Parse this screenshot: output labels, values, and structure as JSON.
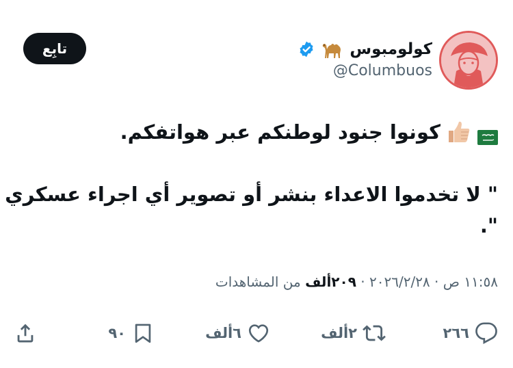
{
  "author": {
    "display_name": "كولومبوس",
    "handle": "@Columbuos",
    "verified": true
  },
  "follow_button": {
    "label": "تابِع"
  },
  "tweet": {
    "line1": "كونوا جنود لوطنكم عبر هواتفكم.",
    "line2": "\" لا تخدموا الاعداء بنشر أو تصوير أي اجراء عسكري",
    "line3": "\".",
    "emojis": [
      "thumbs-up-icon",
      "saudi-flag-icon"
    ]
  },
  "meta": {
    "date_time": "١١:٥٨ ص · ٢٠٢٦/٢/٢٨ · ",
    "views_count": "٢٠٩ألف",
    "views_label": " من المشاهدات"
  },
  "actions": {
    "replies": "٢٦٦",
    "retweets": "٢ألف",
    "likes": "٦ألف",
    "bookmarks": "٩٠"
  },
  "colors": {
    "text": "#0f1419",
    "secondary": "#536471",
    "verified": "#1d9bf0",
    "avatar_border": "#e05a5a",
    "avatar_bg": "#f3c2c2"
  }
}
